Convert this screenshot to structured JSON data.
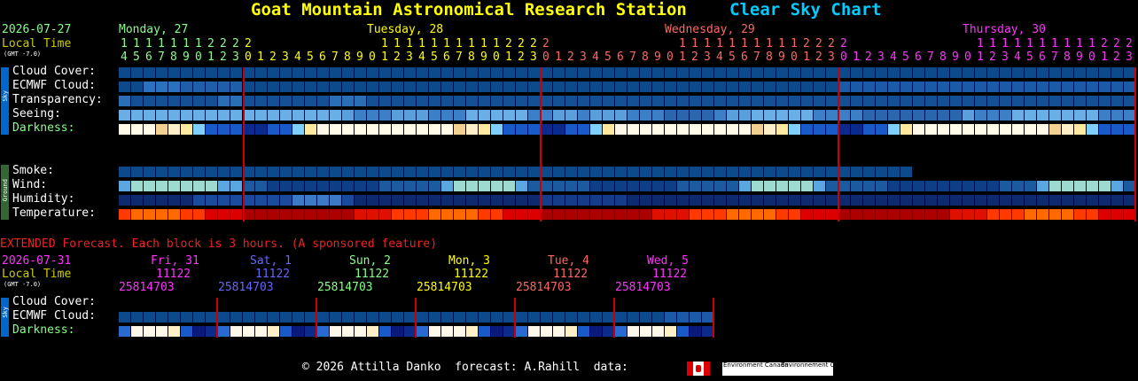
{
  "header": {
    "title": "Goat Mountain Astronomical Research Station",
    "chart_label": "Clear Sky Chart"
  },
  "top": {
    "date": "2026-07-27",
    "local_time": "Local Time",
    "gmt": "(GMT -7.0)",
    "days": [
      {
        "label": "Monday, 27",
        "color": "#8f8"
      },
      {
        "label": "Tuesday, 28",
        "color": "#ff0"
      },
      {
        "label": "Wednesday, 29",
        "color": "#f66"
      },
      {
        "label": "Thursday, 30",
        "color": "#f3f"
      }
    ],
    "hours_row1": "1111111222200000000001111111111222200000000001111111111222200000000001111111111222",
    "hours_row2": "4567890123012345678901234567890123012345678901234567890123012345678901234567890123",
    "rows": [
      {
        "label": "Cloud Cover:",
        "color": "#fff"
      },
      {
        "label": "ECMWF Cloud:",
        "color": "#fff"
      },
      {
        "label": "Transparency:",
        "color": "#fff"
      },
      {
        "label": "Seeing:",
        "color": "#fff"
      },
      {
        "label": "Darkness:",
        "color": "#8f8"
      }
    ],
    "ground_rows": [
      {
        "label": "Smoke:"
      },
      {
        "label": "Wind:"
      },
      {
        "label": "Humidity:"
      },
      {
        "label": "Temperature:"
      }
    ],
    "sky_tag": "Sky",
    "ground_tag": "Ground"
  },
  "extended": {
    "note": "EXTENDED Forecast. Each block is 3 hours. (A sponsored feature)",
    "date": "2026-07-31",
    "local_time": "Local Time",
    "gmt": "(GMT -7.0)",
    "days": [
      {
        "label": "Fri, 31",
        "color": "#f3f"
      },
      {
        "label": "Sat, 1",
        "color": "#66f"
      },
      {
        "label": "Sun, 2",
        "color": "#8f8"
      },
      {
        "label": "Mon, 3",
        "color": "#ff0"
      },
      {
        "label": "Tue, 4",
        "color": "#f66"
      },
      {
        "label": "Wed, 5",
        "color": "#f3f"
      }
    ],
    "hours_row1": " 11122",
    "hours_row2": "25814703",
    "rows": [
      {
        "label": "Cloud Cover:"
      },
      {
        "label": "ECMWF Cloud:"
      },
      {
        "label": "Darkness:"
      }
    ]
  },
  "footer": {
    "text": "© 2026 Attilla Danko  forecast: A.Rahill  data:",
    "org1": "Environment Canada",
    "org2": "Environnement Canada"
  }
}
